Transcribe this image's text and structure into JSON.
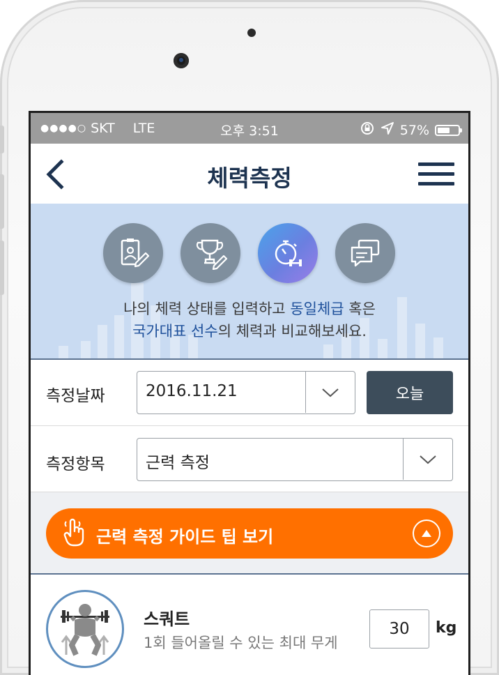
{
  "status_bar": {
    "signal_dots": "●●●●○",
    "carrier": "SKT",
    "network": "LTE",
    "time": "오후 3:51",
    "battery": "57%",
    "icons": [
      "rotation-lock-icon",
      "location-arrow-icon",
      "battery-icon"
    ]
  },
  "nav": {
    "title": "체력측정",
    "back_icon": "chevron-left-icon",
    "menu_icon": "hamburger-menu-icon"
  },
  "banner": {
    "icons": [
      {
        "name": "profile-edit-icon",
        "active": false
      },
      {
        "name": "trophy-edit-icon",
        "active": false
      },
      {
        "name": "stopwatch-dumbbell-icon",
        "active": true
      },
      {
        "name": "chat-bubbles-icon",
        "active": false
      }
    ],
    "line1_a": "나의 체력 상태를 입력하고 ",
    "line1_hl": "동일체급",
    "line1_b": " 혹은",
    "line2_hl": "국가대표 선수",
    "line2_b": "의 체력과 비교해보세요."
  },
  "date_row": {
    "label": "측정날짜",
    "value": "2016.11.21",
    "today_label": "오늘"
  },
  "item_row": {
    "label": "측정항목",
    "value": "근력 측정"
  },
  "guide": {
    "label": "근력 측정 가이드 팁 보기",
    "color": "#ff7000"
  },
  "exercise": {
    "name": "스쿼트",
    "description": "1회 들어올릴 수 있는 최대 무게",
    "value": "30",
    "unit": "kg"
  },
  "colors": {
    "navy": "#1d3350",
    "banner_bg": "#c9dbf2",
    "accent_orange": "#ff7000",
    "dark_button": "#3d4d5b"
  }
}
